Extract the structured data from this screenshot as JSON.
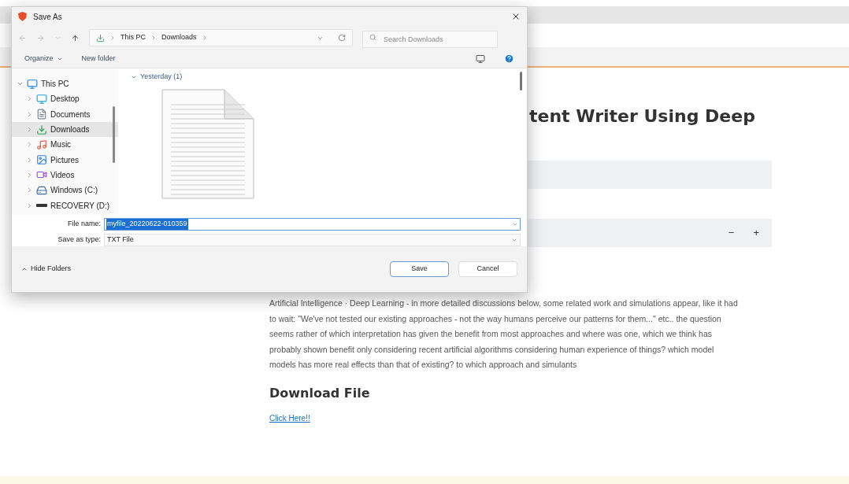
{
  "page": {
    "title": "tent Writer Using Deep",
    "bars": [
      {
        "kind": "plain"
      },
      {
        "kind": "stepper",
        "minus": "−",
        "plus": "+"
      }
    ],
    "paragraph": "Artificial Intelligence  ·  Deep Learning - in more detailed discussions below, some related work and simulations appear, like it had to wait: \"We've not tested our existing approaches - not the way humans perceive our patterns for them...\" etc.. the question seems rather of which interpretation has given the benefit from most approaches and where was one, which we think has probably shown benefit only considering recent artificial algorithms considering human experience of things? which model models has more real effects than that of existing? to which approach and simulants",
    "heading": "Download File",
    "link": "Click Here!!"
  },
  "dialog": {
    "title": "Save As",
    "breadcrumb": [
      "This PC",
      "Downloads"
    ],
    "search": {
      "placeholder": "Search Downloads"
    },
    "toolbar": {
      "organize": "Organize",
      "new_folder": "New folder"
    },
    "tree": [
      {
        "label": "This PC",
        "expanded": true,
        "selected": false,
        "children": [
          {
            "label": "Desktop",
            "expanded": false,
            "selected": false
          },
          {
            "label": "Documents",
            "expanded": false,
            "selected": false
          },
          {
            "label": "Downloads",
            "expanded": false,
            "selected": true
          },
          {
            "label": "Music",
            "expanded": false,
            "selected": false
          },
          {
            "label": "Pictures",
            "expanded": false,
            "selected": false
          },
          {
            "label": "Videos",
            "expanded": false,
            "selected": false
          },
          {
            "label": "Windows (C:)",
            "expanded": false,
            "selected": false
          },
          {
            "label": "RECOVERY (D:)",
            "expanded": false,
            "selected": false
          }
        ]
      }
    ],
    "group": {
      "label": "Yesterday (1)",
      "expanded": true
    },
    "file_name_label": "File name:",
    "file_name": "myfile_20220622-010359",
    "type_label": "Save as type:",
    "type": "TXT File",
    "hide_folders": "Hide Folders",
    "save": "Save",
    "cancel": "Cancel"
  }
}
